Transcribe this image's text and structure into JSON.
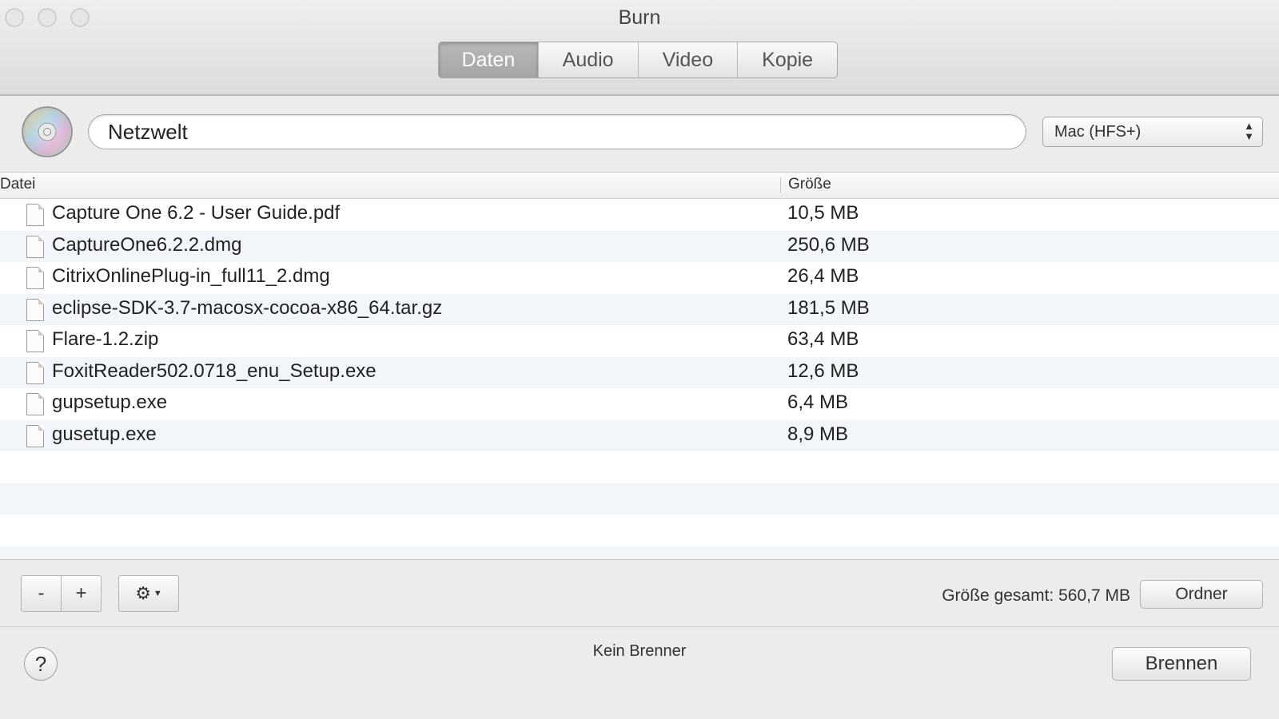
{
  "window": {
    "title": "Burn"
  },
  "tabs": [
    {
      "label": "Daten",
      "active": true
    },
    {
      "label": "Audio",
      "active": false
    },
    {
      "label": "Video",
      "active": false
    },
    {
      "label": "Kopie",
      "active": false
    }
  ],
  "disc": {
    "name": "Netzwelt",
    "icon": "cd-disc-icon"
  },
  "filesystem": {
    "selected": "Mac (HFS+)"
  },
  "table": {
    "columns": [
      "Datei",
      "Größe"
    ],
    "rows": [
      {
        "name": "Capture One 6.2 - User Guide.pdf",
        "size": "10,5 MB"
      },
      {
        "name": "CaptureOne6.2.2.dmg",
        "size": "250,6 MB"
      },
      {
        "name": "CitrixOnlinePlug-in_full11_2.dmg",
        "size": "26,4 MB"
      },
      {
        "name": "eclipse-SDK-3.7-macosx-cocoa-x86_64.tar.gz",
        "size": "181,5 MB"
      },
      {
        "name": "Flare-1.2.zip",
        "size": "63,4 MB"
      },
      {
        "name": "FoxitReader502.0718_enu_Setup.exe",
        "size": "12,6 MB"
      },
      {
        "name": "gupsetup.exe",
        "size": "6,4 MB"
      },
      {
        "name": "gusetup.exe",
        "size": "8,9 MB"
      }
    ]
  },
  "toolbar": {
    "remove_label": "-",
    "add_label": "+",
    "total_label": "Größe gesamt: 560,7 MB",
    "folder_label": "Ordner"
  },
  "footer": {
    "help_label": "?",
    "status": "Kein Brenner",
    "burn_label": "Brennen"
  }
}
